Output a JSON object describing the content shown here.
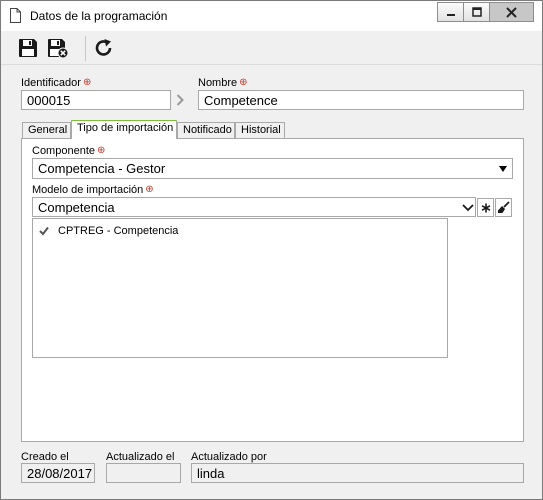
{
  "window": {
    "title": "Datos de la programación",
    "buttons": [
      "minimize-icon",
      "maximize-icon",
      "close-icon"
    ]
  },
  "toolbar": {
    "buttons": [
      {
        "name": "save-icon"
      },
      {
        "name": "save-and-close-icon"
      },
      {
        "name": "refresh-icon"
      }
    ]
  },
  "form": {
    "identificador_label": "Identificador",
    "identificador_value": "000015",
    "nombre_label": "Nombre",
    "nombre_value": "Competence",
    "required_mark": "⊕"
  },
  "tabs": [
    {
      "label": "General",
      "active": false
    },
    {
      "label": "Tipo de importación",
      "active": true
    },
    {
      "label": "Notificado",
      "active": false
    },
    {
      "label": "Historial",
      "active": false
    }
  ],
  "import": {
    "componente_label": "Componente",
    "componente_value": "Competencia - Gestor",
    "modelo_label": "Modelo de importación",
    "modelo_value": "Competencia",
    "items": [
      {
        "label": "CPTREG - Competencia",
        "checked": true
      }
    ]
  },
  "footer": {
    "creado_label": "Creado el",
    "creado_value": "28/08/2017",
    "actualizado_label": "Actualizado el",
    "actualizado_value": "",
    "actualizado_por_label": "Actualizado por",
    "actualizado_por_value": "linda"
  },
  "colors": {
    "required": "#c0392b",
    "active_tab_accent": "#7cbf3a"
  }
}
